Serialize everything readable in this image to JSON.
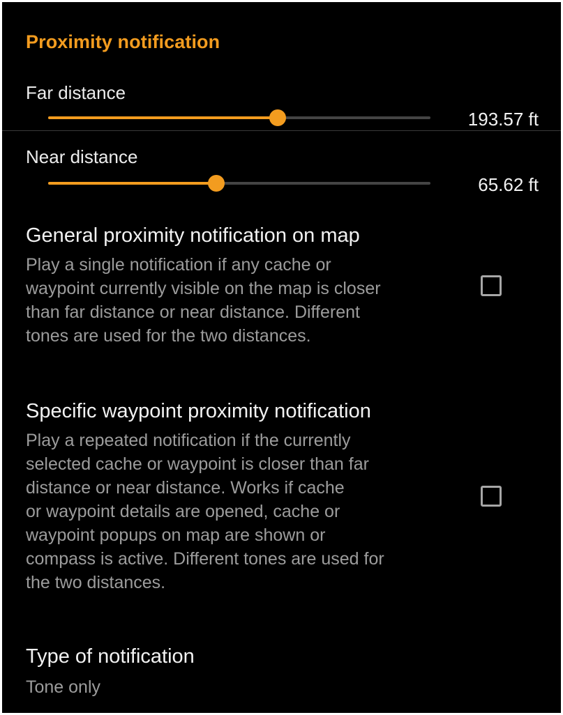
{
  "category": {
    "title": "Proximity notification"
  },
  "far_distance": {
    "label": "Far distance",
    "value_text": "193.57 ft",
    "slider_fraction": 0.6
  },
  "near_distance": {
    "label": "Near distance",
    "value_text": "65.62 ft",
    "slider_fraction": 0.44
  },
  "general_proximity": {
    "title": "General proximity notification on map",
    "summary_lines": [
      "Play a single notification if any cache or",
      "waypoint currently visible on the map is closer",
      "than far distance or near distance. Different",
      "tones are used for the two distances."
    ],
    "checked": false
  },
  "specific_proximity": {
    "title": "Specific waypoint proximity notification",
    "summary_lines": [
      "Play a repeated notification if the currently",
      "selected cache or waypoint is closer than far",
      "distance or near distance. Works if cache",
      "or waypoint details are opened, cache or",
      "waypoint popups on map are shown or",
      "compass is active. Different tones are used for",
      "the two distances."
    ],
    "checked": false
  },
  "notification_type": {
    "title": "Type of notification",
    "value": "Tone only"
  },
  "colors": {
    "accent": "#f39c1f",
    "background": "#000000",
    "primary_text": "#f2f2f2",
    "secondary_text": "#9c9c9c",
    "track_inactive": "#444444"
  }
}
